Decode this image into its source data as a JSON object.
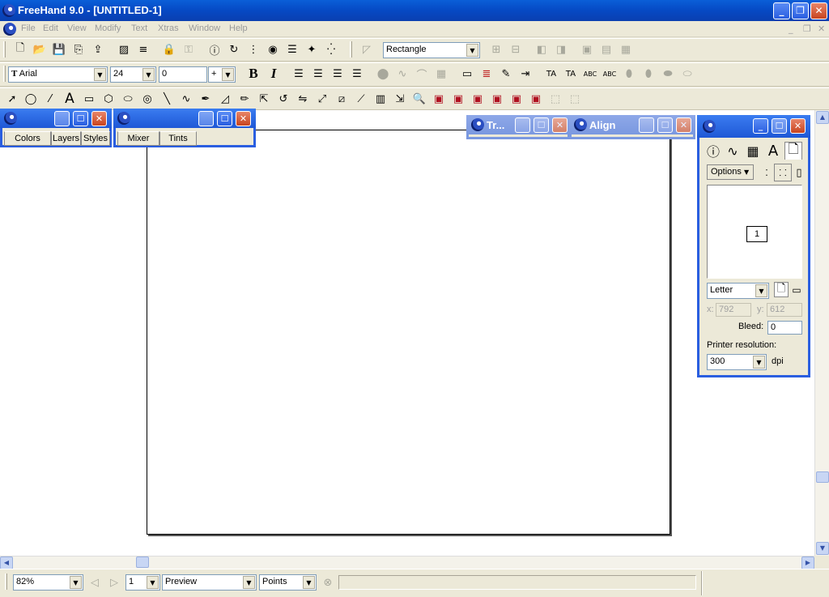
{
  "app": {
    "title": "FreeHand 9.0 - [UNTITLED-1]"
  },
  "menu": [
    "File",
    "Edit",
    "View",
    "Modify",
    "Text",
    "Xtras",
    "Window",
    "Help"
  ],
  "toolbar_main": {
    "shape_select": "Rectangle"
  },
  "text_toolbar": {
    "font": "Arial",
    "size": "24",
    "leading": "0",
    "leading_mode": "+",
    "bold": "B",
    "italic": "I"
  },
  "palettes": {
    "colors": {
      "tabs": [
        "Colors",
        "Layers",
        "Styles"
      ]
    },
    "mixer": {
      "tabs": [
        "Mixer",
        "Tints"
      ]
    },
    "transform": {
      "title": "Tr..."
    },
    "align": {
      "title": "Align"
    },
    "document": {
      "options_label": "Options",
      "page_number": "1",
      "page_size": "Letter",
      "x_label": "x:",
      "x_value": "792",
      "y_label": "y:",
      "y_value": "612",
      "bleed_label": "Bleed:",
      "bleed_value": "0",
      "printer_resolution_label": "Printer resolution:",
      "resolution_value": "300",
      "dpi_label": "dpi"
    }
  },
  "status": {
    "zoom": "82%",
    "page": "1",
    "view_mode": "Preview",
    "units": "Points"
  }
}
